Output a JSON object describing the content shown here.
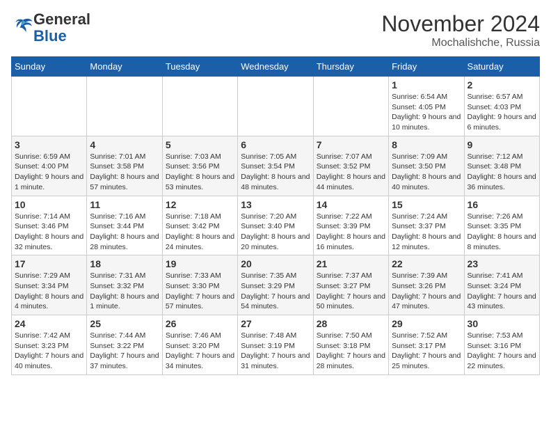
{
  "logo": {
    "text_general": "General",
    "text_blue": "Blue"
  },
  "header": {
    "month": "November 2024",
    "location": "Mochalishche, Russia"
  },
  "days_of_week": [
    "Sunday",
    "Monday",
    "Tuesday",
    "Wednesday",
    "Thursday",
    "Friday",
    "Saturday"
  ],
  "weeks": [
    [
      {
        "day": "",
        "info": ""
      },
      {
        "day": "",
        "info": ""
      },
      {
        "day": "",
        "info": ""
      },
      {
        "day": "",
        "info": ""
      },
      {
        "day": "",
        "info": ""
      },
      {
        "day": "1",
        "info": "Sunrise: 6:54 AM\nSunset: 4:05 PM\nDaylight: 9 hours and 10 minutes."
      },
      {
        "day": "2",
        "info": "Sunrise: 6:57 AM\nSunset: 4:03 PM\nDaylight: 9 hours and 6 minutes."
      }
    ],
    [
      {
        "day": "3",
        "info": "Sunrise: 6:59 AM\nSunset: 4:00 PM\nDaylight: 9 hours and 1 minute."
      },
      {
        "day": "4",
        "info": "Sunrise: 7:01 AM\nSunset: 3:58 PM\nDaylight: 8 hours and 57 minutes."
      },
      {
        "day": "5",
        "info": "Sunrise: 7:03 AM\nSunset: 3:56 PM\nDaylight: 8 hours and 53 minutes."
      },
      {
        "day": "6",
        "info": "Sunrise: 7:05 AM\nSunset: 3:54 PM\nDaylight: 8 hours and 48 minutes."
      },
      {
        "day": "7",
        "info": "Sunrise: 7:07 AM\nSunset: 3:52 PM\nDaylight: 8 hours and 44 minutes."
      },
      {
        "day": "8",
        "info": "Sunrise: 7:09 AM\nSunset: 3:50 PM\nDaylight: 8 hours and 40 minutes."
      },
      {
        "day": "9",
        "info": "Sunrise: 7:12 AM\nSunset: 3:48 PM\nDaylight: 8 hours and 36 minutes."
      }
    ],
    [
      {
        "day": "10",
        "info": "Sunrise: 7:14 AM\nSunset: 3:46 PM\nDaylight: 8 hours and 32 minutes."
      },
      {
        "day": "11",
        "info": "Sunrise: 7:16 AM\nSunset: 3:44 PM\nDaylight: 8 hours and 28 minutes."
      },
      {
        "day": "12",
        "info": "Sunrise: 7:18 AM\nSunset: 3:42 PM\nDaylight: 8 hours and 24 minutes."
      },
      {
        "day": "13",
        "info": "Sunrise: 7:20 AM\nSunset: 3:40 PM\nDaylight: 8 hours and 20 minutes."
      },
      {
        "day": "14",
        "info": "Sunrise: 7:22 AM\nSunset: 3:39 PM\nDaylight: 8 hours and 16 minutes."
      },
      {
        "day": "15",
        "info": "Sunrise: 7:24 AM\nSunset: 3:37 PM\nDaylight: 8 hours and 12 minutes."
      },
      {
        "day": "16",
        "info": "Sunrise: 7:26 AM\nSunset: 3:35 PM\nDaylight: 8 hours and 8 minutes."
      }
    ],
    [
      {
        "day": "17",
        "info": "Sunrise: 7:29 AM\nSunset: 3:34 PM\nDaylight: 8 hours and 4 minutes."
      },
      {
        "day": "18",
        "info": "Sunrise: 7:31 AM\nSunset: 3:32 PM\nDaylight: 8 hours and 1 minute."
      },
      {
        "day": "19",
        "info": "Sunrise: 7:33 AM\nSunset: 3:30 PM\nDaylight: 7 hours and 57 minutes."
      },
      {
        "day": "20",
        "info": "Sunrise: 7:35 AM\nSunset: 3:29 PM\nDaylight: 7 hours and 54 minutes."
      },
      {
        "day": "21",
        "info": "Sunrise: 7:37 AM\nSunset: 3:27 PM\nDaylight: 7 hours and 50 minutes."
      },
      {
        "day": "22",
        "info": "Sunrise: 7:39 AM\nSunset: 3:26 PM\nDaylight: 7 hours and 47 minutes."
      },
      {
        "day": "23",
        "info": "Sunrise: 7:41 AM\nSunset: 3:24 PM\nDaylight: 7 hours and 43 minutes."
      }
    ],
    [
      {
        "day": "24",
        "info": "Sunrise: 7:42 AM\nSunset: 3:23 PM\nDaylight: 7 hours and 40 minutes."
      },
      {
        "day": "25",
        "info": "Sunrise: 7:44 AM\nSunset: 3:22 PM\nDaylight: 7 hours and 37 minutes."
      },
      {
        "day": "26",
        "info": "Sunrise: 7:46 AM\nSunset: 3:20 PM\nDaylight: 7 hours and 34 minutes."
      },
      {
        "day": "27",
        "info": "Sunrise: 7:48 AM\nSunset: 3:19 PM\nDaylight: 7 hours and 31 minutes."
      },
      {
        "day": "28",
        "info": "Sunrise: 7:50 AM\nSunset: 3:18 PM\nDaylight: 7 hours and 28 minutes."
      },
      {
        "day": "29",
        "info": "Sunrise: 7:52 AM\nSunset: 3:17 PM\nDaylight: 7 hours and 25 minutes."
      },
      {
        "day": "30",
        "info": "Sunrise: 7:53 AM\nSunset: 3:16 PM\nDaylight: 7 hours and 22 minutes."
      }
    ]
  ]
}
